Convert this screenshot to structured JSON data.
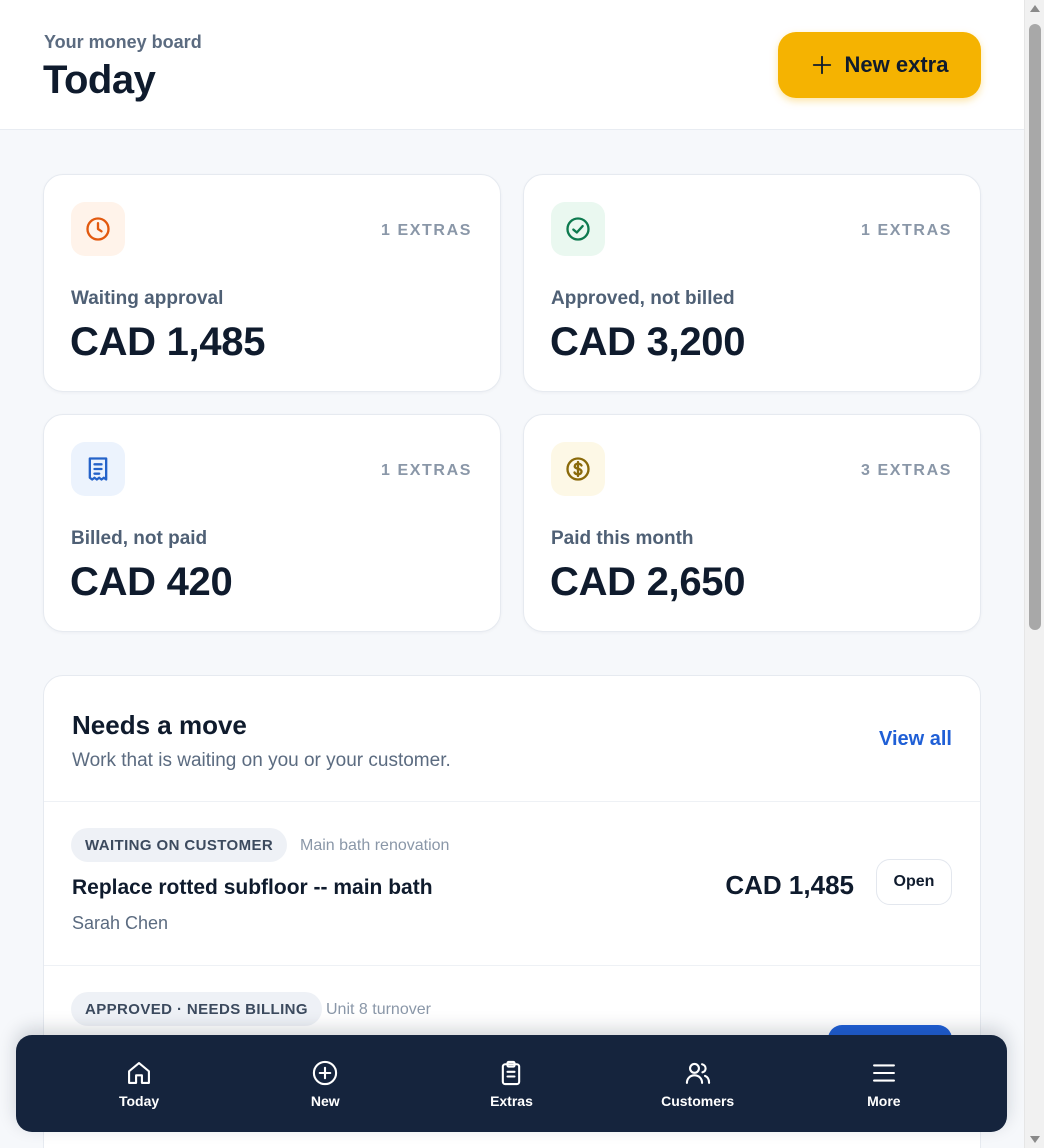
{
  "header": {
    "eyebrow": "Your money board",
    "title": "Today",
    "new_extra_label": "New extra"
  },
  "stats": [
    {
      "icon": "clock-icon",
      "count": "1 EXTRAS",
      "label": "Waiting approval",
      "amount": "CAD 1,485",
      "tint": "#fff3ea",
      "color": "#e2590f"
    },
    {
      "icon": "check-circle-icon",
      "count": "1 EXTRAS",
      "label": "Approved, not billed",
      "amount": "CAD 3,200",
      "tint": "#eaf8f0",
      "color": "#0e7a4f"
    },
    {
      "icon": "receipt-icon",
      "count": "1 EXTRAS",
      "label": "Billed, not paid",
      "amount": "CAD 420",
      "tint": "#ecf3fd",
      "color": "#2563c9"
    },
    {
      "icon": "dollar-circle-icon",
      "count": "3 EXTRAS",
      "label": "Paid this month",
      "amount": "CAD 2,650",
      "tint": "#fdf8e6",
      "color": "#8a6a0a"
    }
  ],
  "needs_move": {
    "title": "Needs a move",
    "subtitle": "Work that is waiting on you or your customer.",
    "view_all": "View all",
    "items": [
      {
        "status": "WAITING ON CUSTOMER",
        "project": "Main bath renovation",
        "title": "Replace rotted subfloor -- main bath",
        "customer": "Sarah Chen",
        "amount": "CAD 1,485",
        "action": "Open"
      },
      {
        "status": "APPROVED · NEEDS BILLING",
        "project": "Unit 8 turnover"
      }
    ]
  },
  "nav": [
    {
      "icon": "home-icon",
      "label": "Today"
    },
    {
      "icon": "plus-circle-icon",
      "label": "New"
    },
    {
      "icon": "clipboard-icon",
      "label": "Extras"
    },
    {
      "icon": "users-icon",
      "label": "Customers"
    },
    {
      "icon": "menu-icon",
      "label": "More"
    }
  ],
  "colors": {
    "accent": "#f5b301",
    "link": "#1f5fd6",
    "nav_bg": "#15243d"
  }
}
